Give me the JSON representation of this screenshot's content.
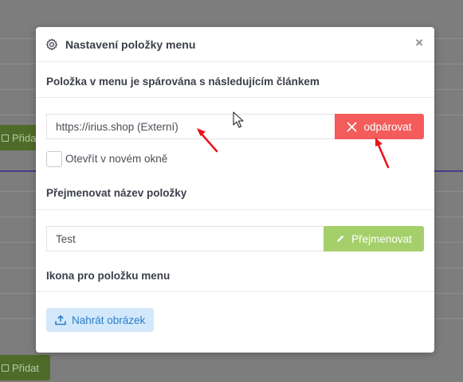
{
  "background": {
    "add_button_label": "Přidat"
  },
  "modal": {
    "title": "Nastavení položky menu",
    "close_symbol": "×",
    "paired_section": {
      "heading": "Položka v menu je spárována s následujícím článkem",
      "url_value": "https://irius.shop (Externí)",
      "unpair_label": "odpárovat",
      "new_window_label": "Otevřít v novém okně",
      "new_window_checked": false
    },
    "rename_section": {
      "heading": "Přejmenovat název položky",
      "name_value": "Test",
      "rename_label": "Přejmenovat"
    },
    "icon_section": {
      "heading": "Ikona pro položku menu",
      "upload_label": "Nahrát obrázek"
    }
  },
  "colors": {
    "danger": "#f45b5b",
    "success": "#a5cf6a",
    "info_bg": "#d3e8fb",
    "info_text": "#2a7ec8",
    "annotation": "#e8141b"
  },
  "icons": {
    "settings": "gear-icon",
    "unpair": "x-icon",
    "rename": "pencil-icon",
    "upload": "upload-icon"
  }
}
